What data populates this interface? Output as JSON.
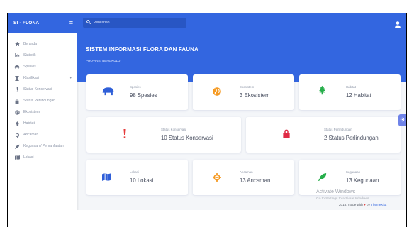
{
  "brand": {
    "name": "SI - FLONA"
  },
  "topbar": {
    "search_placeholder": "Pencarian..."
  },
  "sidebar": {
    "items": [
      {
        "label": "Beranda",
        "icon": "home-icon"
      },
      {
        "label": "Statistik",
        "icon": "chart-icon"
      },
      {
        "label": "Spesies",
        "icon": "paw-icon"
      },
      {
        "label": "Klasifikasi",
        "icon": "hourglass-icon",
        "has_submenu": true
      },
      {
        "label": "Status Konservasi",
        "icon": "exclamation-icon"
      },
      {
        "label": "Status Perlindungan",
        "icon": "lock-icon"
      },
      {
        "label": "Ekosistem",
        "icon": "globe-icon"
      },
      {
        "label": "Habitat",
        "icon": "tree-icon"
      },
      {
        "label": "Ancaman",
        "icon": "crosshair-icon"
      },
      {
        "label": "Kegunaan / Pemanfaatan",
        "icon": "leaf-icon"
      },
      {
        "label": "Lokasi",
        "icon": "map-icon"
      }
    ]
  },
  "header": {
    "title": "SISTEM INFORMASI FLORA DAN FAUNA",
    "subtitle": "PROVINSI BENGKULU"
  },
  "cards": {
    "spesies": {
      "label": "Spesies",
      "value": "98 Spesies",
      "color": "#2f5fd8"
    },
    "ekosistem": {
      "label": "Ekosistem",
      "value": "3 Ekosistem",
      "color": "#f59a23"
    },
    "habitat": {
      "label": "Habitat",
      "value": "12 Habitat",
      "color": "#27ae4b"
    },
    "status_konservasi": {
      "label": "Status Konservasi",
      "value": "10 Status Konservasi",
      "color": "#e53b3b"
    },
    "status_perlindungan": {
      "label": "Status Perlindungan",
      "value": "2 Status Perlindungan",
      "color": "#e02a45"
    },
    "lokasi": {
      "label": "Lokasi",
      "value": "10 Lokasi",
      "color": "#2f5fd8"
    },
    "ancaman": {
      "label": "Ancaman",
      "value": "13 Ancaman",
      "color": "#f59a23"
    },
    "kegunaan": {
      "label": "Kegunaan",
      "value": "13 Kegunaan",
      "color": "#27ae4b"
    }
  },
  "footer": {
    "watermark_title": "Activate Windows",
    "watermark_sub": "Go to Settings to activate Windows.",
    "credit_prefix": "2018, made with",
    "credit_by": "by",
    "credit_brand": "ThemeKita"
  },
  "colors": {
    "primary": "#3366e0",
    "background": "#f4f6f9"
  }
}
